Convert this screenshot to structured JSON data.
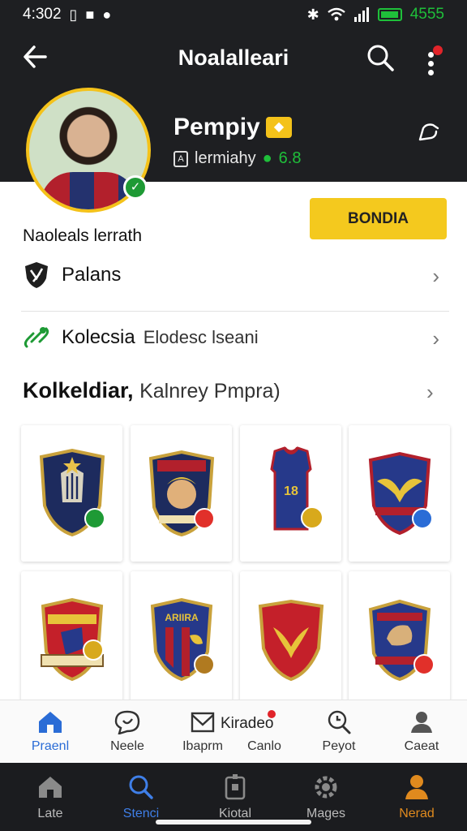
{
  "status_bar": {
    "time": "4:302",
    "battery": "4555"
  },
  "header": {
    "title": "Noalalleari",
    "profile_name": "Pempiy",
    "profile_sub": "lermiahy",
    "profile_sub_extra": "6.8"
  },
  "body": {
    "join_label": "Naoleals lerrath",
    "cta_label": "BONDIA",
    "rows": [
      {
        "label": "Palans",
        "sub": ""
      },
      {
        "label": "Kolecsia",
        "sub": "Elodesc lseani"
      }
    ],
    "section": {
      "title": "Kolkeldiar,",
      "sub": "Kalnrey Pmpra)"
    }
  },
  "tabs": [
    {
      "label": "Praenl"
    },
    {
      "label": "Neele"
    },
    {
      "label": "Ibaprm"
    },
    {
      "label": "Canlo"
    },
    {
      "label": "Peyot"
    },
    {
      "label": "Caeat"
    }
  ],
  "tab_inline_label": "Kiradeo",
  "system_tabs": [
    {
      "label": "Late"
    },
    {
      "label": "Stenci"
    },
    {
      "label": "Kiotal"
    },
    {
      "label": "Mages"
    },
    {
      "label": "Nerad"
    }
  ],
  "colors": {
    "header_bg": "#1e1f22",
    "accent_yellow": "#f4c91e",
    "active_blue": "#2a6cd6",
    "status_green": "#1fbf3a",
    "badge_red": "#e1242a"
  },
  "cards": [
    {
      "icon": "shield-crest-icon",
      "label": ""
    },
    {
      "icon": "warrior-badge-icon",
      "label": ""
    },
    {
      "icon": "jersey-icon",
      "label": "18"
    },
    {
      "icon": "eagle-shield-icon",
      "label": ""
    },
    {
      "icon": "club-crest-icon",
      "label": ""
    },
    {
      "icon": "striped-crest-icon",
      "label": "ARIIRA"
    },
    {
      "icon": "bird-shield-icon",
      "label": ""
    },
    {
      "icon": "knight-crest-icon",
      "label": ""
    }
  ]
}
